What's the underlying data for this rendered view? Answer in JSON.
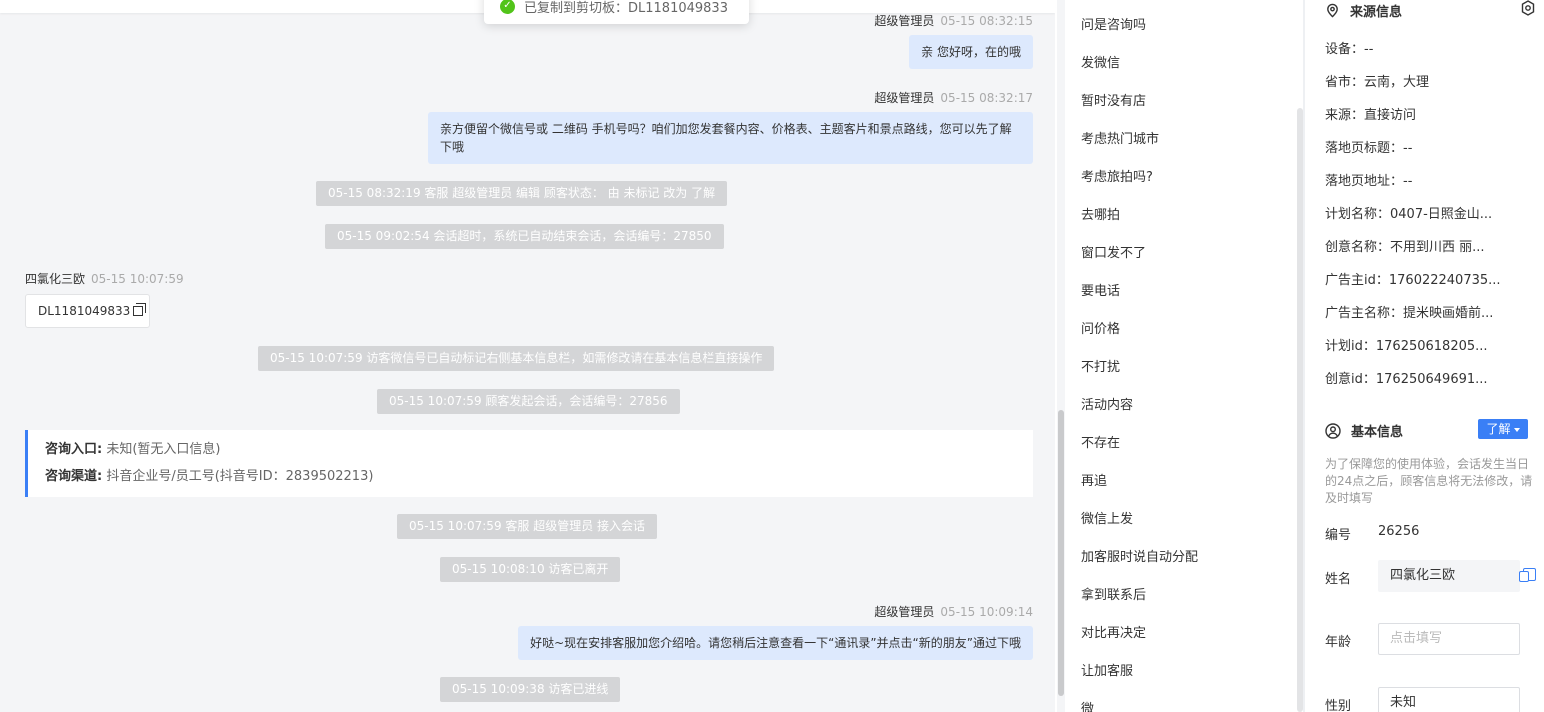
{
  "toast": {
    "text": "已复制到剪切板：DL1181049833"
  },
  "chat": {
    "msg1": {
      "sender": "超级管理员",
      "time": "05-15 08:32:15",
      "text": "亲 您好呀，在的哦"
    },
    "msg2": {
      "sender": "超级管理员",
      "time": "05-15 08:32:17",
      "text": "亲方便留个微信号或 二维码 手机号吗？咱们加您发套餐内容、价格表、主题客片和景点路线，您可以先了解下哦"
    },
    "sys1": "05-15 08:32:19 客服 超级管理员 编辑 顾客状态： 由 未标记 改为 了解",
    "sys2": "05-15 09:02:54 会话超时，系统已自动结束会话，会话编号：27850",
    "visitor": {
      "name": "四氯化三欧",
      "time": "05-15 10:07:59",
      "code": "DL1181049833"
    },
    "sys3": "05-15 10:07:59 访客微信号已自动标记右侧基本信息栏，如需修改请在基本信息栏直接操作",
    "sys4": "05-15 10:07:59 顾客发起会话，会话编号：27856",
    "info_card": {
      "entry_label": "咨询入口:",
      "entry_value": "未知(暂无入口信息)",
      "channel_label": "咨询渠道:",
      "channel_value": "抖音企业号/员工号(抖音号ID：2839502213)"
    },
    "sys5": "05-15 10:07:59 客服 超级管理员 接入会话",
    "sys6": "05-15 10:08:10 访客已离开",
    "msg3": {
      "sender": "超级管理员",
      "time": "05-15 10:09:14",
      "text": "好哒~现在安排客服加您介绍哈。请您稍后注意查看一下“通讯录”并点击“新的朋友”通过下哦"
    },
    "sys7": "05-15 10:09:38 访客已进线"
  },
  "quick_replies": [
    "问是咨询吗",
    "发微信",
    "暂时没有店",
    "考虑热门城市",
    "考虑旅拍吗?",
    "去哪拍",
    "窗口发不了",
    "要电话",
    "问价格",
    "不打扰",
    "活动内容",
    "不存在",
    "再追",
    "微信上发",
    "加客服时说自动分配",
    "拿到联系后",
    "对比再决定",
    "让加客服",
    "微"
  ],
  "source": {
    "title": "来源信息",
    "rows": [
      {
        "label": "设备：",
        "value": "--"
      },
      {
        "label": "省市：",
        "value": "云南，大理"
      },
      {
        "label": "来源：",
        "value": "直接访问"
      },
      {
        "label": "落地页标题：",
        "value": "--"
      },
      {
        "label": "落地页地址：",
        "value": "--"
      },
      {
        "label": "计划名称：",
        "value": "0407-日照金山..."
      },
      {
        "label": "创意名称：",
        "value": "不用到川西 丽..."
      },
      {
        "label": "广告主id：",
        "value": "176022240735..."
      },
      {
        "label": "广告主名称：",
        "value": "提米映画婚前..."
      },
      {
        "label": "计划id：",
        "value": "176250618205..."
      },
      {
        "label": "创意id：",
        "value": "176250649691..."
      }
    ]
  },
  "basic": {
    "title": "基本信息",
    "status_tag": "了解",
    "notice": "为了保障您的使用体验，会话发生当日的24点之后，顾客信息将无法修改，请及时填写",
    "id_label": "编号",
    "id_value": "26256",
    "name_label": "姓名",
    "name_value": "四氯化三欧",
    "age_label": "年龄",
    "age_placeholder": "点击填写",
    "gender_label": "性别",
    "gender_value": "未知"
  },
  "colors": {
    "accent": "#3a7ff6",
    "bubble": "#dde9fd",
    "system": "#d4d5d7",
    "success": "#52c41a"
  }
}
